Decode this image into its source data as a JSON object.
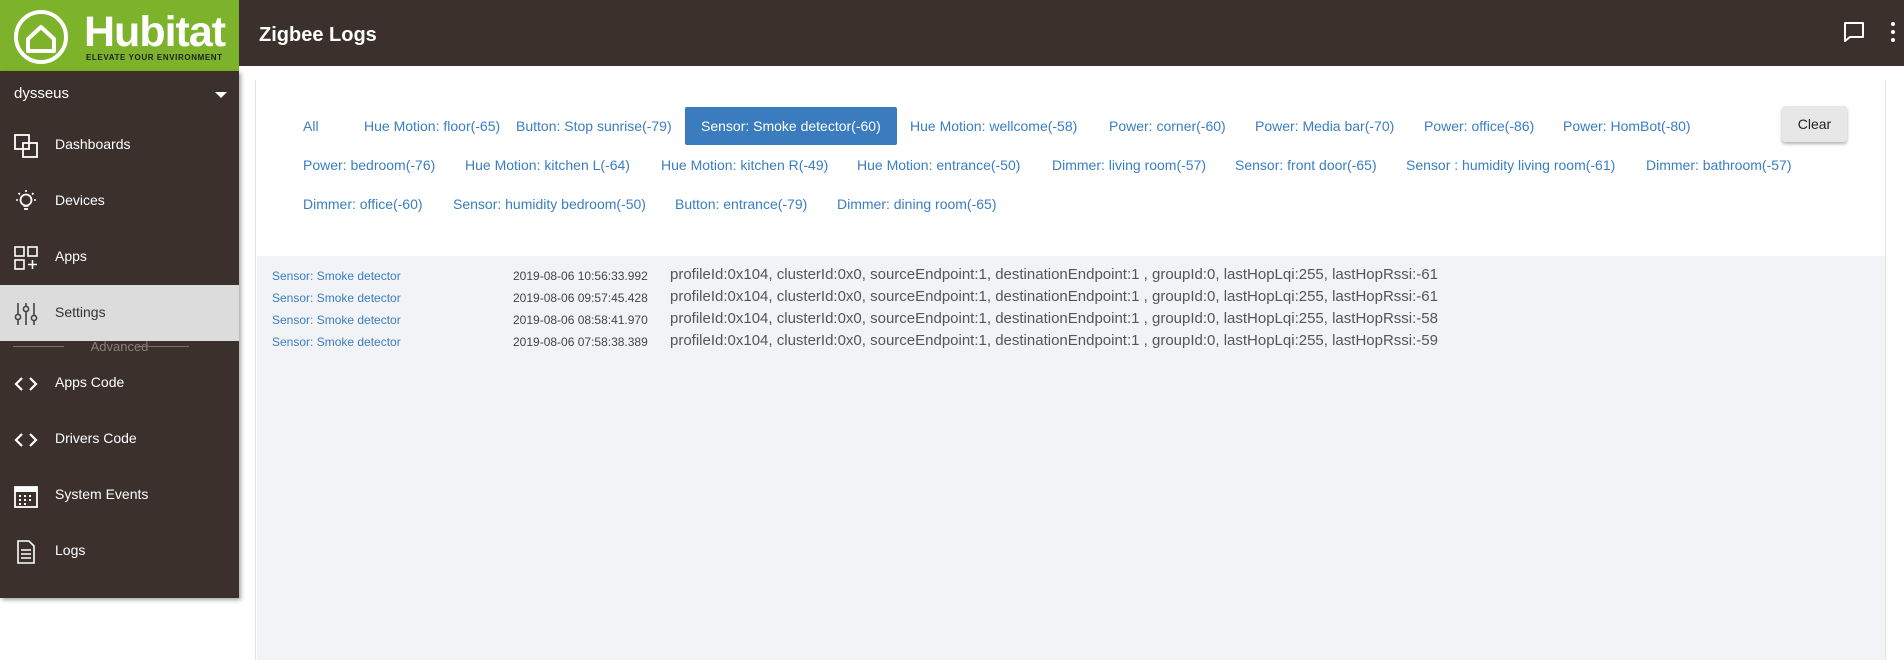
{
  "header": {
    "title": "Zigbee Logs"
  },
  "logo": {
    "name": "Hubitat",
    "tagline": "ELEVATE YOUR ENVIRONMENT",
    "color": "#7cb32a"
  },
  "sidebar": {
    "user": "dysseus",
    "items": [
      {
        "label": "Dashboards",
        "icon": "dashboards-icon"
      },
      {
        "label": "Devices",
        "icon": "lightbulb-icon"
      },
      {
        "label": "Apps",
        "icon": "apps-grid-icon"
      },
      {
        "label": "Settings",
        "icon": "sliders-icon",
        "active": true
      },
      {
        "label": "Apps Code",
        "icon": "code-icon"
      },
      {
        "label": "Drivers Code",
        "icon": "code-icon"
      },
      {
        "label": "System Events",
        "icon": "calendar-icon"
      },
      {
        "label": "Logs",
        "icon": "document-icon"
      }
    ],
    "advanced_label": "Advanced"
  },
  "filters": {
    "items": [
      "All",
      "Hue Motion: floor(-65)",
      "Button: Stop sunrise(-79)",
      "Sensor: Smoke detector(-60)",
      "Hue Motion: wellcome(-58)",
      "Power: corner(-60)",
      "Power: Media bar(-70)",
      "Power: office(-86)",
      "Power: HomBot(-80)",
      "Power: bedroom(-76)",
      "Hue Motion: kitchen L(-64)",
      "Hue Motion: kitchen R(-49)",
      "Hue Motion: entrance(-50)",
      "Dimmer: living room(-57)",
      "Sensor: front door(-65)",
      "Sensor : humidity living room(-61)",
      "Dimmer: bathroom(-57)",
      "Dimmer: office(-60)",
      "Sensor: humidity bedroom(-50)",
      "Button: entrance(-79)",
      "Dimmer: dining room(-65)"
    ],
    "active": "Sensor: Smoke detector(-60)",
    "clear_label": "Clear"
  },
  "logs": [
    {
      "source": "Sensor: Smoke detector",
      "time": "2019-08-06 10:56:33.992",
      "message": "profileId:0x104, clusterId:0x0, sourceEndpoint:1, destinationEndpoint:1 , groupId:0, lastHopLqi:255, lastHopRssi:-61"
    },
    {
      "source": "Sensor: Smoke detector",
      "time": "2019-08-06 09:57:45.428",
      "message": "profileId:0x104, clusterId:0x0, sourceEndpoint:1, destinationEndpoint:1 , groupId:0, lastHopLqi:255, lastHopRssi:-61"
    },
    {
      "source": "Sensor: Smoke detector",
      "time": "2019-08-06 08:58:41.970",
      "message": "profileId:0x104, clusterId:0x0, sourceEndpoint:1, destinationEndpoint:1 , groupId:0, lastHopLqi:255, lastHopRssi:-58"
    },
    {
      "source": "Sensor: Smoke detector",
      "time": "2019-08-06 07:58:38.389",
      "message": "profileId:0x104, clusterId:0x0, sourceEndpoint:1, destinationEndpoint:1 , groupId:0, lastHopLqi:255, lastHopRssi:-59"
    }
  ],
  "colors": {
    "topbar": "#3b302c",
    "accent": "#3a7cbd",
    "log_bg": "#f2f3f6"
  }
}
